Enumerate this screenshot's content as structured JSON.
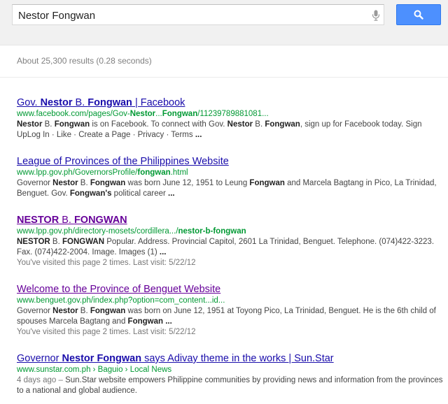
{
  "search": {
    "query": "Nestor Fongwan"
  },
  "stats": "About 25,300 results (0.28 seconds)",
  "results": [
    {
      "title": [
        {
          "text": "Gov. ",
          "b": false
        },
        {
          "text": "Nestor",
          "b": true
        },
        {
          "text": " B. ",
          "b": false
        },
        {
          "text": "Fongwan",
          "b": true
        },
        {
          "text": " | Facebook",
          "b": false
        }
      ],
      "url": [
        {
          "text": "www.facebook.com/pages/Gov-",
          "b": false
        },
        {
          "text": "Nestor",
          "b": true
        },
        {
          "text": "...",
          "b": false
        },
        {
          "text": "Fongwan",
          "b": true
        },
        {
          "text": "/11239789881081...",
          "b": false
        }
      ],
      "snippet": [
        {
          "text": "Nestor",
          "b": true
        },
        {
          "text": " B. ",
          "b": false
        },
        {
          "text": "Fongwan",
          "b": true
        },
        {
          "text": " is on Facebook. To connect with Gov. ",
          "b": false
        },
        {
          "text": "Nestor",
          "b": true
        },
        {
          "text": " B. ",
          "b": false
        },
        {
          "text": "Fongwan",
          "b": true
        },
        {
          "text": ", sign up for Facebook today. Sign UpLog In · Like · Create a Page · Privacy · Terms ",
          "b": false
        },
        {
          "text": "...",
          "b": true
        }
      ],
      "visited": false,
      "visited_note": ""
    },
    {
      "title": [
        {
          "text": "League of Provinces of the Philippines Website",
          "b": false
        }
      ],
      "url": [
        {
          "text": "www.lpp.gov.ph/GovernorsProfile/",
          "b": false
        },
        {
          "text": "fongwan",
          "b": true
        },
        {
          "text": ".html",
          "b": false
        }
      ],
      "snippet": [
        {
          "text": "Governor ",
          "b": false
        },
        {
          "text": "Nestor",
          "b": true
        },
        {
          "text": " B. ",
          "b": false
        },
        {
          "text": "Fongwan",
          "b": true
        },
        {
          "text": " was born June 12, 1951 to Leung ",
          "b": false
        },
        {
          "text": "Fongwan",
          "b": true
        },
        {
          "text": " and Marcela Bagtang in Pico, La Trinidad, Benguet. Gov. ",
          "b": false
        },
        {
          "text": "Fongwan's",
          "b": true
        },
        {
          "text": " political career ",
          "b": false
        },
        {
          "text": "...",
          "b": true
        }
      ],
      "visited": false,
      "visited_note": ""
    },
    {
      "title": [
        {
          "text": "NESTOR",
          "b": true
        },
        {
          "text": " B. ",
          "b": false
        },
        {
          "text": "FONGWAN",
          "b": true
        }
      ],
      "url": [
        {
          "text": "www.lpp.gov.ph/directory-mosets/cordillera.../",
          "b": false
        },
        {
          "text": "nestor-b-fongwan",
          "b": true
        }
      ],
      "snippet": [
        {
          "text": "NESTOR",
          "b": true
        },
        {
          "text": " B. ",
          "b": false
        },
        {
          "text": "FONGWAN",
          "b": true
        },
        {
          "text": " Popular. Address. Provincial Capitol, 2601 La Trinidad, Benguet. Telephone. (074)422-3223. Fax. (074)422-2004. Image. Images (1) ",
          "b": false
        },
        {
          "text": "...",
          "b": true
        }
      ],
      "visited": true,
      "visited_note": "You've visited this page 2 times. Last visit: 5/22/12"
    },
    {
      "title": [
        {
          "text": "Welcome to the Province of Benguet Website",
          "b": false
        }
      ],
      "url": [
        {
          "text": "www.benguet.gov.ph/index.php?option=com_content...id...",
          "b": false
        }
      ],
      "snippet": [
        {
          "text": "Governor ",
          "b": false
        },
        {
          "text": "Nestor",
          "b": true
        },
        {
          "text": " B. ",
          "b": false
        },
        {
          "text": "Fongwan",
          "b": true
        },
        {
          "text": " was born on June 12, 1951 at Toyong Pico, La Trinidad, Benguet. He is the 6th child of spouses Marcela Bagtang and ",
          "b": false
        },
        {
          "text": "Fongwan",
          "b": true
        },
        {
          "text": " ",
          "b": false
        },
        {
          "text": "...",
          "b": true
        }
      ],
      "visited": true,
      "visited_note": "You've visited this page 2 times. Last visit: 5/22/12"
    },
    {
      "title": [
        {
          "text": "Governor ",
          "b": false
        },
        {
          "text": "Nestor Fongwan",
          "b": true
        },
        {
          "text": " says Adivay theme in the works | Sun.Star",
          "b": false
        }
      ],
      "url": [
        {
          "text": "www.sunstar.com.ph › Baguio › Local News",
          "b": false
        }
      ],
      "snippet": [
        {
          "text": "4 days ago – ",
          "b": false,
          "date": true
        },
        {
          "text": "Sun.Star website empowers Philippine communities by providing news and information from the provinces to a national and global audience.",
          "b": false
        }
      ],
      "visited": false,
      "visited_note": ""
    }
  ],
  "icons": {
    "mic": "microphone-icon",
    "search": "search-icon"
  },
  "colors": {
    "link": "#1a0dab",
    "visited_link": "#660099",
    "url": "#009933",
    "button": "#4d90fe"
  }
}
